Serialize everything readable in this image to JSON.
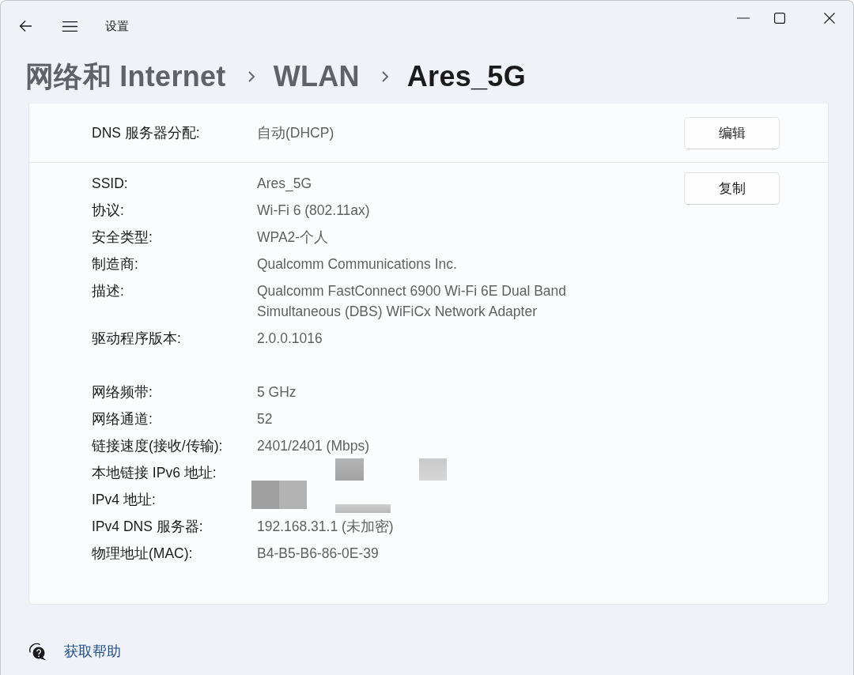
{
  "window": {
    "title": "设置"
  },
  "breadcrumb": [
    {
      "label": "网络和 Internet",
      "current": false
    },
    {
      "label": "WLAN",
      "current": false
    },
    {
      "label": "Ares_5G",
      "current": true
    }
  ],
  "dns_assignment": {
    "label": "DNS 服务器分配:",
    "value": "自动(DHCP)",
    "button": "编辑"
  },
  "properties": {
    "button": "复制",
    "groups": [
      {
        "rows": [
          {
            "label": "SSID:",
            "value": "Ares_5G",
            "redacted": false
          },
          {
            "label": "协议:",
            "value": "Wi-Fi 6 (802.11ax)",
            "redacted": false
          },
          {
            "label": "安全类型:",
            "value": "WPA2-个人",
            "redacted": false
          },
          {
            "label": "制造商:",
            "value": "Qualcomm Communications Inc.",
            "redacted": false
          },
          {
            "label": "描述:",
            "value": "Qualcomm FastConnect 6900 Wi-Fi 6E Dual Band Simultaneous (DBS) WiFiCx Network Adapter",
            "redacted": false
          },
          {
            "label": "驱动程序版本:",
            "value": "2.0.0.1016",
            "redacted": false
          }
        ]
      },
      {
        "rows": [
          {
            "label": "网络频带:",
            "value": "5 GHz",
            "redacted": false
          },
          {
            "label": "网络通道:",
            "value": "52",
            "redacted": false
          },
          {
            "label": "链接速度(接收/传输):",
            "value": "2401/2401 (Mbps)",
            "redacted": false
          },
          {
            "label": "本地链接 IPv6 地址:",
            "redacted": true
          },
          {
            "label": "IPv4 地址:",
            "redacted": true
          },
          {
            "label": "IPv4 DNS 服务器:",
            "value": "192.168.31.1 (未加密)",
            "redacted": false
          },
          {
            "label": "物理地址(MAC):",
            "value": "B4-B5-B6-86-0E-39",
            "redacted": false
          }
        ]
      }
    ]
  },
  "help_link": {
    "label": "获取帮助"
  }
}
